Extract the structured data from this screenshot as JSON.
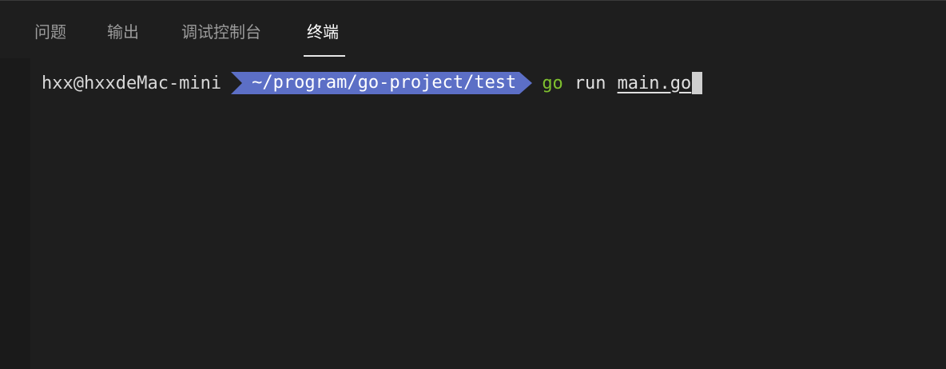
{
  "tabs": [
    {
      "label": "问题",
      "active": false
    },
    {
      "label": "输出",
      "active": false
    },
    {
      "label": "调试控制台",
      "active": false
    },
    {
      "label": "终端",
      "active": true
    }
  ],
  "terminal": {
    "user_host": "hxx@hxxdeMac-mini",
    "path": "~/program/go-project/test",
    "command": "go",
    "arg_run": "run",
    "arg_file": "main.go"
  },
  "colors": {
    "background": "#1e1e1e",
    "path_segment": "#5c6fc6",
    "command": "#7fc02f",
    "active_tab": "#ffffff",
    "inactive_tab": "#9b9b9b"
  }
}
